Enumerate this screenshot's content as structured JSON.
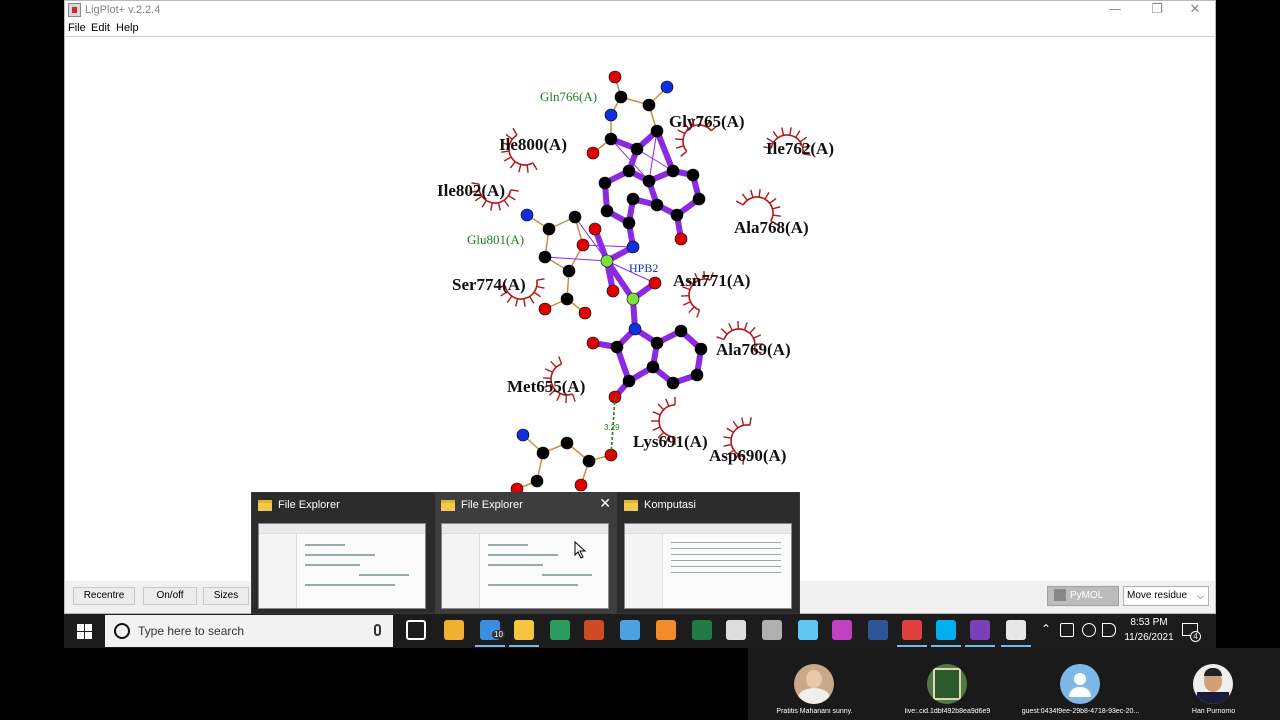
{
  "window": {
    "title": "LigPlot+ v.2.2.4",
    "controls": {
      "minimize": "—",
      "maximize": "❐",
      "close": "✕"
    }
  },
  "menu": [
    "File",
    "Edit",
    "Help"
  ],
  "plot": {
    "ligand_label": "HPB2",
    "hbond_distance": "3.29",
    "residues": [
      {
        "id": "gln766",
        "text": "Gln766(A)",
        "kind": "hbond"
      },
      {
        "id": "glu801",
        "text": "Glu801(A)",
        "kind": "hbond"
      },
      {
        "id": "gly765",
        "text": "Gly765(A)",
        "kind": "hydrophobic"
      },
      {
        "id": "ile800",
        "text": "Ile800(A)",
        "kind": "hydrophobic"
      },
      {
        "id": "ile762",
        "text": "Ile762(A)",
        "kind": "hydrophobic"
      },
      {
        "id": "ile802",
        "text": "Ile802(A)",
        "kind": "hydrophobic"
      },
      {
        "id": "ala768",
        "text": "Ala768(A)",
        "kind": "hydrophobic"
      },
      {
        "id": "ser774",
        "text": "Ser774(A)",
        "kind": "hydrophobic"
      },
      {
        "id": "asn771",
        "text": "Asn771(A)",
        "kind": "hydrophobic"
      },
      {
        "id": "ala769",
        "text": "Ala769(A)",
        "kind": "hydrophobic"
      },
      {
        "id": "met655",
        "text": "Met655(A)",
        "kind": "hydrophobic"
      },
      {
        "id": "lys691",
        "text": "Lys691(A)",
        "kind": "hydrophobic"
      },
      {
        "id": "asp690",
        "text": "Asp690(A)",
        "kind": "hydrophobic"
      }
    ],
    "colors": {
      "bond": "#8a2be2",
      "carbon": "#000000",
      "oxygen": "#e00000",
      "nitrogen": "#1030e0",
      "sulfur": "#80e040",
      "hbond": "#208020",
      "arc": "#b01818",
      "side_bond": "#c89040"
    }
  },
  "bottom_bar": {
    "recentre": "Recentre",
    "onoff": "On/off",
    "sizes": "Sizes",
    "pymol": "PyMOL",
    "move_mode": "Move residue"
  },
  "taskbar_thumbnails": [
    {
      "title": "File Explorer"
    },
    {
      "title": "File Explorer",
      "close": "✕"
    },
    {
      "title": "Komputasi"
    }
  ],
  "taskbar": {
    "search_placeholder": "Type here to search",
    "mail_badge": "10",
    "time": "8:53 PM",
    "date": "11/26/2021",
    "notification_count": "4",
    "pinned_apps": [
      "task-view",
      "store",
      "mail",
      "file-explorer",
      "app-green",
      "powerpoint",
      "app-blue",
      "app-orange",
      "excel",
      "calculator",
      "app-gray",
      "app-search",
      "app-purple",
      "word",
      "app-red",
      "skype",
      "app-shield",
      "app-java"
    ]
  },
  "participants": [
    {
      "name": "Pratitis Mahanani sunny."
    },
    {
      "name": "live:.cid.1dbf492b8ea9d6e9"
    },
    {
      "name": "guest:0434f9ee-29b8-4718-93ec-20..."
    },
    {
      "name": "Hari Purnomo"
    }
  ]
}
